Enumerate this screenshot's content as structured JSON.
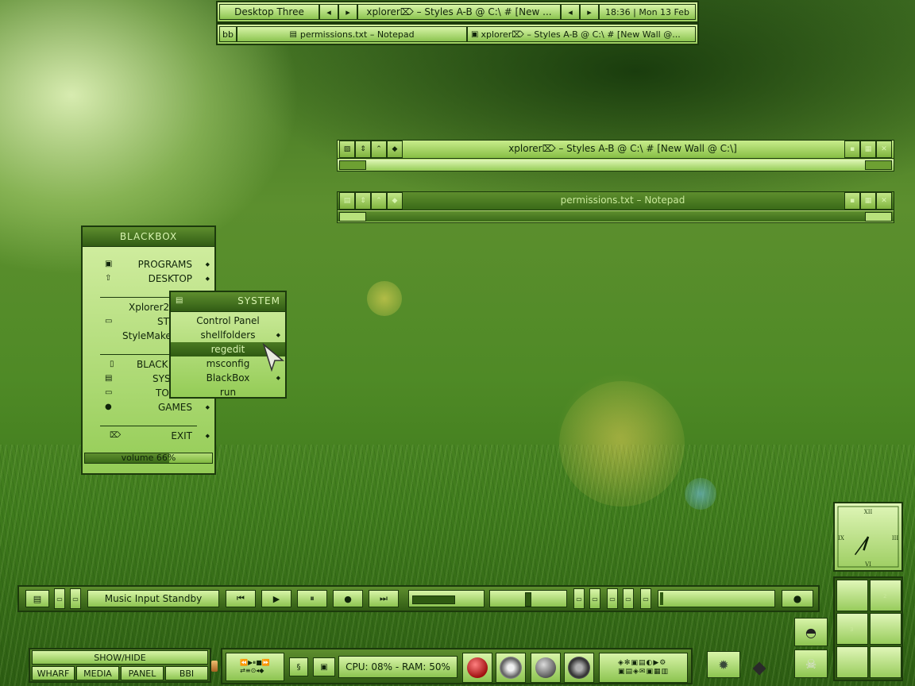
{
  "toolbar": {
    "workspace": "Desktop Three",
    "prev_icon": "triangle-left-icon",
    "next_icon": "triangle-right-icon",
    "window_title": "xplorer⌦ – Styles A-B @ C:\\ # [New ...",
    "clock": "18:36 | Mon 13 Feb"
  },
  "taskbar": {
    "label": "bb",
    "tasks": [
      {
        "label": "permissions.txt – Notepad",
        "icon": "notepad-icon"
      },
      {
        "label": "xplorer⌦ – Styles A-B @ C:\\ # [New Wall @...",
        "icon": "explorer-icon"
      }
    ]
  },
  "window1": {
    "title": "xplorer⌦ – Styles A-B @ C:\\ # [New Wall @ C:\\]",
    "icon": "folder-icon"
  },
  "window2": {
    "title": "permissions.txt – Notepad",
    "icon": "notepad-icon"
  },
  "menu": {
    "title": "BLACKBOX",
    "items": [
      {
        "label": "PROGRAMS",
        "icon": "windows-icon",
        "submenu": true
      },
      {
        "label": "DESKTOP",
        "icon": "arrow-up-icon",
        "submenu": true
      },
      {
        "label": "Xplorer2",
        "icon": "",
        "submenu": false
      },
      {
        "label": "ST",
        "icon": "window-icon",
        "submenu": false
      },
      {
        "label": "StyleMake",
        "icon": "",
        "submenu": false
      },
      {
        "label": "BLACK",
        "icon": "box-icon",
        "submenu": false
      },
      {
        "label": "SYS",
        "icon": "monitor-icon",
        "submenu": false
      },
      {
        "label": "TO",
        "icon": "window-icon",
        "submenu": false
      },
      {
        "label": "GAMES",
        "icon": "alien-icon",
        "submenu": true
      },
      {
        "label": "EXIT",
        "icon": "exit-icon",
        "submenu": true
      }
    ],
    "volume": "volume 66%",
    "volume_level": 0.66
  },
  "submenu": {
    "title": "SYSTEM",
    "icon": "monitor-icon",
    "items": [
      {
        "label": "Control Panel",
        "submenu": false
      },
      {
        "label": "shellfolders",
        "submenu": true
      },
      {
        "label": "regedit",
        "submenu": false,
        "active": true
      },
      {
        "label": "msconfig",
        "submenu": false
      },
      {
        "label": "BlackBox",
        "submenu": true
      },
      {
        "label": "run",
        "submenu": false
      }
    ]
  },
  "clock_widget": {
    "numerals": [
      "XII",
      "III",
      "VI",
      "IX"
    ],
    "hour": 6,
    "minute": 36
  },
  "media": {
    "track": "Music Input Standby",
    "prev_icon": "skip-back-icon",
    "play_icon": "play-icon",
    "pause_icon": "pause-icon",
    "stop_icon": "stop-icon",
    "next_icon": "skip-forward-icon",
    "alien_icon": "alien-icon"
  },
  "pager": {
    "desks": [
      "2",
      "3"
    ]
  },
  "bottom": {
    "show_hide": "SHOW/HIDE",
    "tabs": [
      "WHARF",
      "MEDIA",
      "PANEL",
      "BBI"
    ],
    "cpu": "CPU: 08% - RAM: 50%"
  }
}
